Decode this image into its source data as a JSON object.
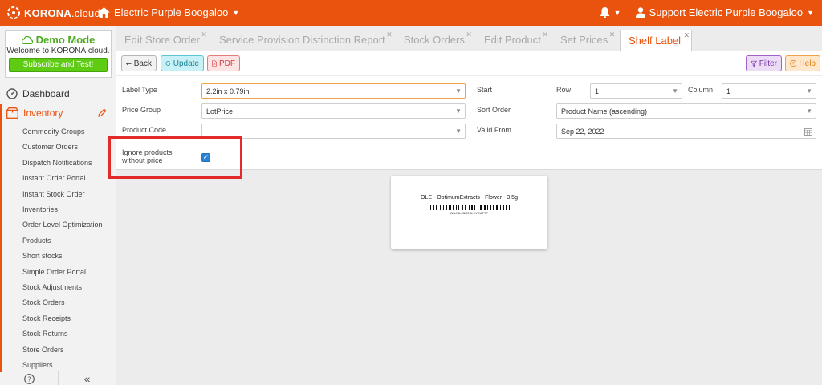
{
  "header": {
    "logo_text": "KORONA",
    "logo_suffix": ".cloud",
    "store_name": "Electric Purple Boogaloo",
    "user_name": "Support Electric Purple Boogaloo"
  },
  "sidebar": {
    "demo": {
      "title": "Demo Mode",
      "subtitle": "Welcome to KORONA.cloud.",
      "button": "Subscribe and Test!"
    },
    "dashboard": "Dashboard",
    "inventory": "Inventory",
    "sub_items": [
      "Commodity Groups",
      "Customer Orders",
      "Dispatch Notifications",
      "Instant Order Portal",
      "Instant Stock Order",
      "Inventories",
      "Order Level Optimization",
      "Products",
      "Short stocks",
      "Simple Order Portal",
      "Stock Adjustments",
      "Stock Orders",
      "Stock Receipts",
      "Stock Returns",
      "Store Orders",
      "Suppliers"
    ]
  },
  "tabs": [
    {
      "label": "Edit Store Order"
    },
    {
      "label": "Service Provision Distinction Report"
    },
    {
      "label": "Stock Orders"
    },
    {
      "label": "Edit Product"
    },
    {
      "label": "Set Prices"
    },
    {
      "label": "Shelf Label",
      "active": true
    }
  ],
  "toolbar": {
    "back": "Back",
    "update": "Update",
    "pdf": "PDF",
    "filter": "Filter",
    "help": "Help"
  },
  "form": {
    "label_type": {
      "label": "Label Type",
      "value": "2.2in x 0.79in"
    },
    "price_group": {
      "label": "Price Group",
      "value": "LotPrice"
    },
    "product_code": {
      "label": "Product Code",
      "value": ""
    },
    "ignore_products": {
      "label": "Ignore products without price",
      "checked": true
    },
    "start": {
      "label": "Start"
    },
    "row": {
      "label": "Row",
      "value": "1"
    },
    "column": {
      "label": "Column",
      "value": "1"
    },
    "sort_order": {
      "label": "Sort Order",
      "value": "Product Name (ascending)"
    },
    "valid_from": {
      "label": "Valid From",
      "value": "Sep 22, 2022"
    }
  },
  "preview": {
    "product_line": "OLE - OptimumExtracts - Flower - 3.5g",
    "barcode_text": "WAJ4L45K03L9VCAT7F"
  },
  "colors": {
    "brand": "#e9530d",
    "demo_green": "#5dcc13",
    "checkbox_blue": "#2b83d8",
    "highlight_red": "#e22a2a"
  }
}
